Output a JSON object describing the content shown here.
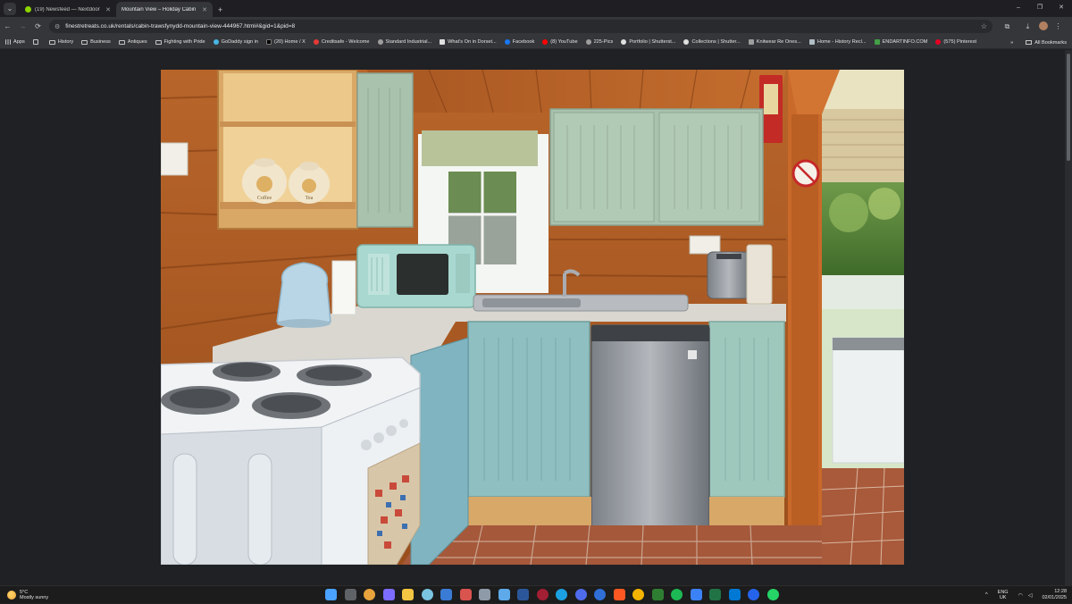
{
  "browser": {
    "tabs": [
      {
        "title": "(19) Newsfeed — Nextdoor",
        "active": false,
        "favicon_color": "#8ed500"
      },
      {
        "title": "Mountain View – Holiday Cabin",
        "active": true,
        "favicon_color": "#ffffff"
      }
    ],
    "new_tab_symbol": "+",
    "window_controls": [
      "–",
      "❐",
      "✕"
    ],
    "nav": {
      "back": "←",
      "forward": "→",
      "reload": "⟳"
    },
    "url": "finestretreats.co.uk/rentals/cabin-trawsfynydd-mountain-view-444967.html#&gid=1&pid=8",
    "star_symbol": "☆"
  },
  "bookmarks": {
    "items": [
      {
        "label": "Apps",
        "type": "grid"
      },
      {
        "label": "",
        "type": "grid2"
      },
      {
        "label": "History",
        "type": "folder"
      },
      {
        "label": "Business",
        "type": "folder"
      },
      {
        "label": "Antiques",
        "type": "folder"
      },
      {
        "label": "Fighting with Pride",
        "type": "folder"
      },
      {
        "label": "GoDaddy sign in",
        "type": "icon",
        "color": "#47b6e4"
      },
      {
        "label": "(20) Home / X",
        "type": "icon",
        "color": "#000000"
      },
      {
        "label": "Creditsafe - Welcome",
        "type": "icon",
        "color": "#e53935"
      },
      {
        "label": "Standard Industrial...",
        "type": "icon",
        "color": "#9e9e9e"
      },
      {
        "label": "What's On in Dorset...",
        "type": "icon",
        "color": "#e0e0e0"
      },
      {
        "label": "Facebook",
        "type": "icon",
        "color": "#1877f2"
      },
      {
        "label": "(8) YouTube",
        "type": "icon",
        "color": "#ff0000"
      },
      {
        "label": "225-Pics",
        "type": "icon",
        "color": "#9e9e9e"
      },
      {
        "label": "Portfolio | Shutterst...",
        "type": "icon",
        "color": "#e0e0e0"
      },
      {
        "label": "Collections | Shutter...",
        "type": "icon",
        "color": "#e0e0e0"
      },
      {
        "label": "Knitwear Re Ones...",
        "type": "icon",
        "color": "#9e9e9e"
      },
      {
        "label": "Home - History Recl...",
        "type": "icon",
        "color": "#b0bec5"
      },
      {
        "label": "ENDARTINFO.COM",
        "type": "icon",
        "color": "#43a047"
      },
      {
        "label": "(575) Pinterest",
        "type": "icon",
        "color": "#e60023"
      }
    ],
    "overflow": "»",
    "all_bookmarks": "All Bookmarks"
  },
  "photo": {
    "subject": "cabin kitchen with pine log walls, sage-green cabinets, white electric cooker, mint microwave, kettle and stainless fridge",
    "canisters": [
      "Coffee",
      "Tea"
    ]
  },
  "taskbar": {
    "weather": {
      "temp": "5°C",
      "condition": "Mostly sunny"
    },
    "apps": [
      {
        "name": "start",
        "color": "#4aa3ff"
      },
      {
        "name": "search",
        "color": "#5f6368"
      },
      {
        "name": "chrome",
        "color": "#e8a33d"
      },
      {
        "name": "copilot",
        "color": "#7c6cff"
      },
      {
        "name": "explorer",
        "color": "#f4c542"
      },
      {
        "name": "app-1",
        "color": "#7ac4e0"
      },
      {
        "name": "defender",
        "color": "#3a7bd5"
      },
      {
        "name": "app-2",
        "color": "#d9534f"
      },
      {
        "name": "calculator",
        "color": "#8e9aa7"
      },
      {
        "name": "app-3",
        "color": "#5da9e9"
      },
      {
        "name": "word",
        "color": "#2b579a"
      },
      {
        "name": "app-4",
        "color": "#a31f34"
      },
      {
        "name": "edge",
        "color": "#1ba1e2"
      },
      {
        "name": "app-5",
        "color": "#4f6bed"
      },
      {
        "name": "app-6",
        "color": "#2f6fd6"
      },
      {
        "name": "brave",
        "color": "#ff5722"
      },
      {
        "name": "app-7",
        "color": "#f4b400"
      },
      {
        "name": "app-8",
        "color": "#2e7d32"
      },
      {
        "name": "spotify",
        "color": "#1db954"
      },
      {
        "name": "app-9",
        "color": "#3b82f6"
      },
      {
        "name": "excel",
        "color": "#217346"
      },
      {
        "name": "outlook",
        "color": "#0078d4"
      },
      {
        "name": "app-10",
        "color": "#2563eb"
      },
      {
        "name": "whatsapp",
        "color": "#25d366"
      }
    ],
    "tray": {
      "chevron": "^",
      "lang_line1": "ENG",
      "lang_line2": "UK",
      "wifi": "◠",
      "volume": "◁",
      "time": "12:28",
      "date": "02/01/2025"
    }
  }
}
